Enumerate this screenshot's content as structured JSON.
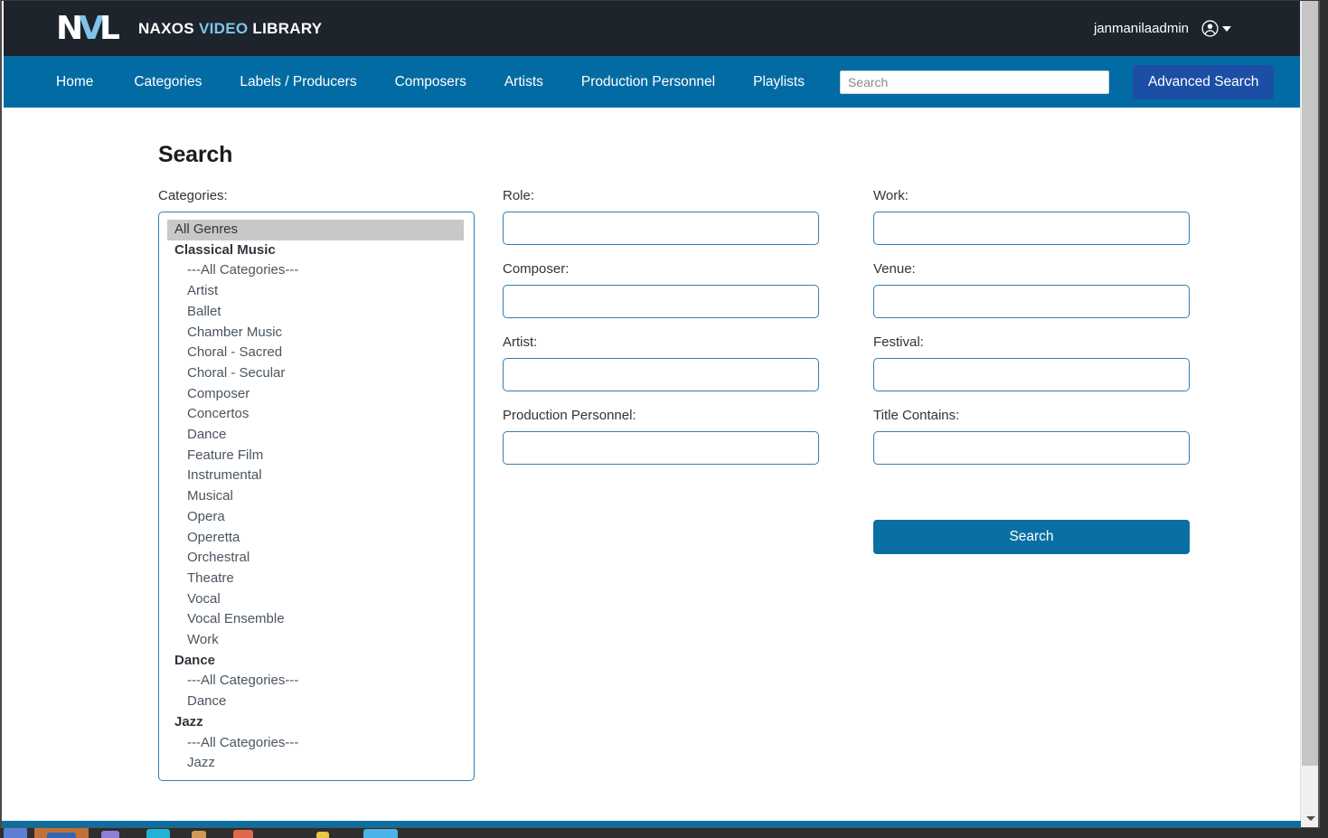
{
  "header": {
    "logo_text": {
      "n": "N",
      "v": "V",
      "l": "L"
    },
    "brand_naxos": "NAXOS",
    "brand_video": "VIDEO",
    "brand_library": "LIBRARY",
    "username": "janmanilaadmin",
    "user_icon": "person-circle-icon",
    "caret_icon": "chevron-down-icon",
    "bg_color": "#1d242c"
  },
  "nav": {
    "bg_color": "#036ba4",
    "links": [
      {
        "label": "Home",
        "name": "nav-home"
      },
      {
        "label": "Categories",
        "name": "nav-categories"
      },
      {
        "label": "Labels / Producers",
        "name": "nav-labels-producers"
      },
      {
        "label": "Composers",
        "name": "nav-composers"
      },
      {
        "label": "Artists",
        "name": "nav-artists"
      },
      {
        "label": "Production Personnel",
        "name": "nav-production-personnel"
      },
      {
        "label": "Playlists",
        "name": "nav-playlists"
      }
    ],
    "search_placeholder": "Search",
    "search_value": "",
    "advanced_search_label": "Advanced Search",
    "advanced_search_color": "#1d4ea6"
  },
  "main": {
    "page_title": "Search",
    "categories_label": "Categories:",
    "categories": [
      {
        "label": "All Genres",
        "type": "option",
        "selected": true
      },
      {
        "label": "Classical Music",
        "type": "group"
      },
      {
        "label": "---All Categories---",
        "type": "option"
      },
      {
        "label": "Artist",
        "type": "option"
      },
      {
        "label": "Ballet",
        "type": "option"
      },
      {
        "label": "Chamber Music",
        "type": "option"
      },
      {
        "label": "Choral - Sacred",
        "type": "option"
      },
      {
        "label": "Choral - Secular",
        "type": "option"
      },
      {
        "label": "Composer",
        "type": "option"
      },
      {
        "label": "Concertos",
        "type": "option"
      },
      {
        "label": "Dance",
        "type": "option"
      },
      {
        "label": "Feature Film",
        "type": "option"
      },
      {
        "label": "Instrumental",
        "type": "option"
      },
      {
        "label": "Musical",
        "type": "option"
      },
      {
        "label": "Opera",
        "type": "option"
      },
      {
        "label": "Operetta",
        "type": "option"
      },
      {
        "label": "Orchestral",
        "type": "option"
      },
      {
        "label": "Theatre",
        "type": "option"
      },
      {
        "label": "Vocal",
        "type": "option"
      },
      {
        "label": "Vocal Ensemble",
        "type": "option"
      },
      {
        "label": "Work",
        "type": "option"
      },
      {
        "label": "Dance",
        "type": "group"
      },
      {
        "label": "---All Categories---",
        "type": "option"
      },
      {
        "label": "Dance",
        "type": "option"
      },
      {
        "label": "Jazz",
        "type": "group"
      },
      {
        "label": "---All Categories---",
        "type": "option"
      },
      {
        "label": "Jazz",
        "type": "option"
      }
    ],
    "form_left": [
      {
        "label": "Role:",
        "value": "",
        "name": "role"
      },
      {
        "label": "Composer:",
        "value": "",
        "name": "composer"
      },
      {
        "label": "Artist:",
        "value": "",
        "name": "artist"
      },
      {
        "label": "Production Personnel:",
        "value": "",
        "name": "production-personnel"
      }
    ],
    "form_right": [
      {
        "label": "Work:",
        "value": "",
        "name": "work"
      },
      {
        "label": "Venue:",
        "value": "",
        "name": "venue"
      },
      {
        "label": "Festival:",
        "value": "",
        "name": "festival"
      },
      {
        "label": "Title Contains:",
        "value": "",
        "name": "title-contains"
      }
    ],
    "submit_label": "Search",
    "submit_color": "#0a6fa3"
  },
  "browser": {
    "scrollbar_track_color": "#f0f0f0",
    "scrollbar_thumb_color": "#c5c5c5",
    "scroll_down_arrow": "chevron-down-icon"
  }
}
